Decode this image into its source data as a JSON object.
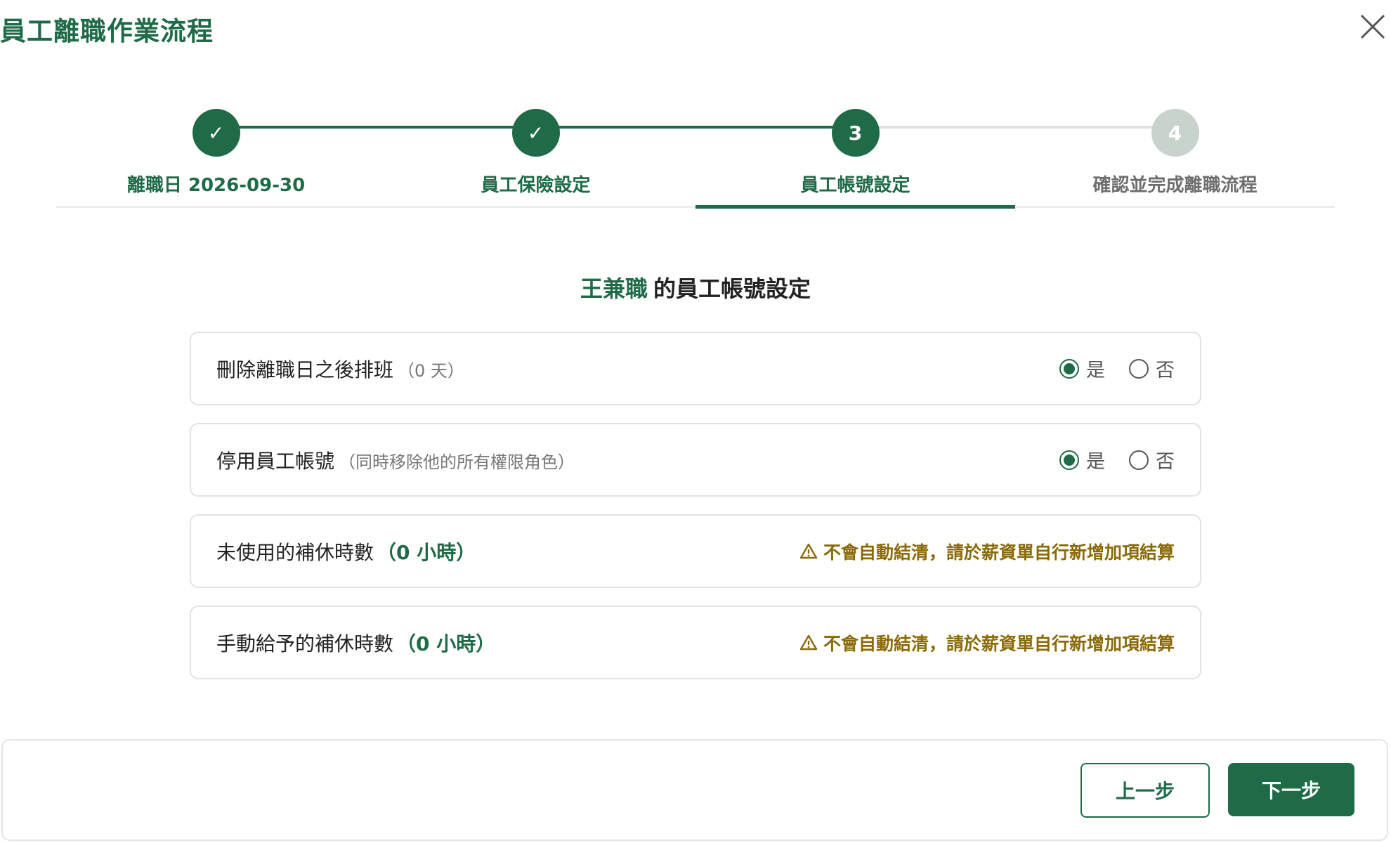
{
  "window": {
    "title": "員工離職作業流程"
  },
  "stepper": {
    "steps": [
      {
        "label": "離職日 2026-09-30",
        "marker": "✓",
        "state": "done"
      },
      {
        "label": "員工保險設定",
        "marker": "✓",
        "state": "done"
      },
      {
        "label": "員工帳號設定",
        "marker": "3",
        "state": "active"
      },
      {
        "label": "確認並完成離職流程",
        "marker": "4",
        "state": "todo"
      }
    ]
  },
  "section": {
    "employee_name": "王兼職",
    "heading_suffix": "的員工帳號設定"
  },
  "settings": {
    "delete_schedule": {
      "label": "刪除離職日之後排班",
      "note": "（0 天）",
      "selected": "是"
    },
    "disable_account": {
      "label": "停用員工帳號",
      "note": "（同時移除他的所有權限角色）",
      "selected": "是"
    },
    "unused_comp_hours": {
      "label": "未使用的補休時數",
      "hours": "（0 小時）",
      "warning": "不會自動結清，請於薪資單自行新增加項結算"
    },
    "manual_comp_hours": {
      "label": "手動給予的補休時數",
      "hours": "（0 小時）",
      "warning": "不會自動結清，請於薪資單自行新增加項結算"
    },
    "options": {
      "yes": "是",
      "no": "否"
    }
  },
  "footer": {
    "prev_label": "上一步",
    "next_label": "下一步"
  },
  "colors": {
    "brand": "#1f6b48",
    "warning": "#8a6a06",
    "todo_step": "#c9d3cd"
  }
}
